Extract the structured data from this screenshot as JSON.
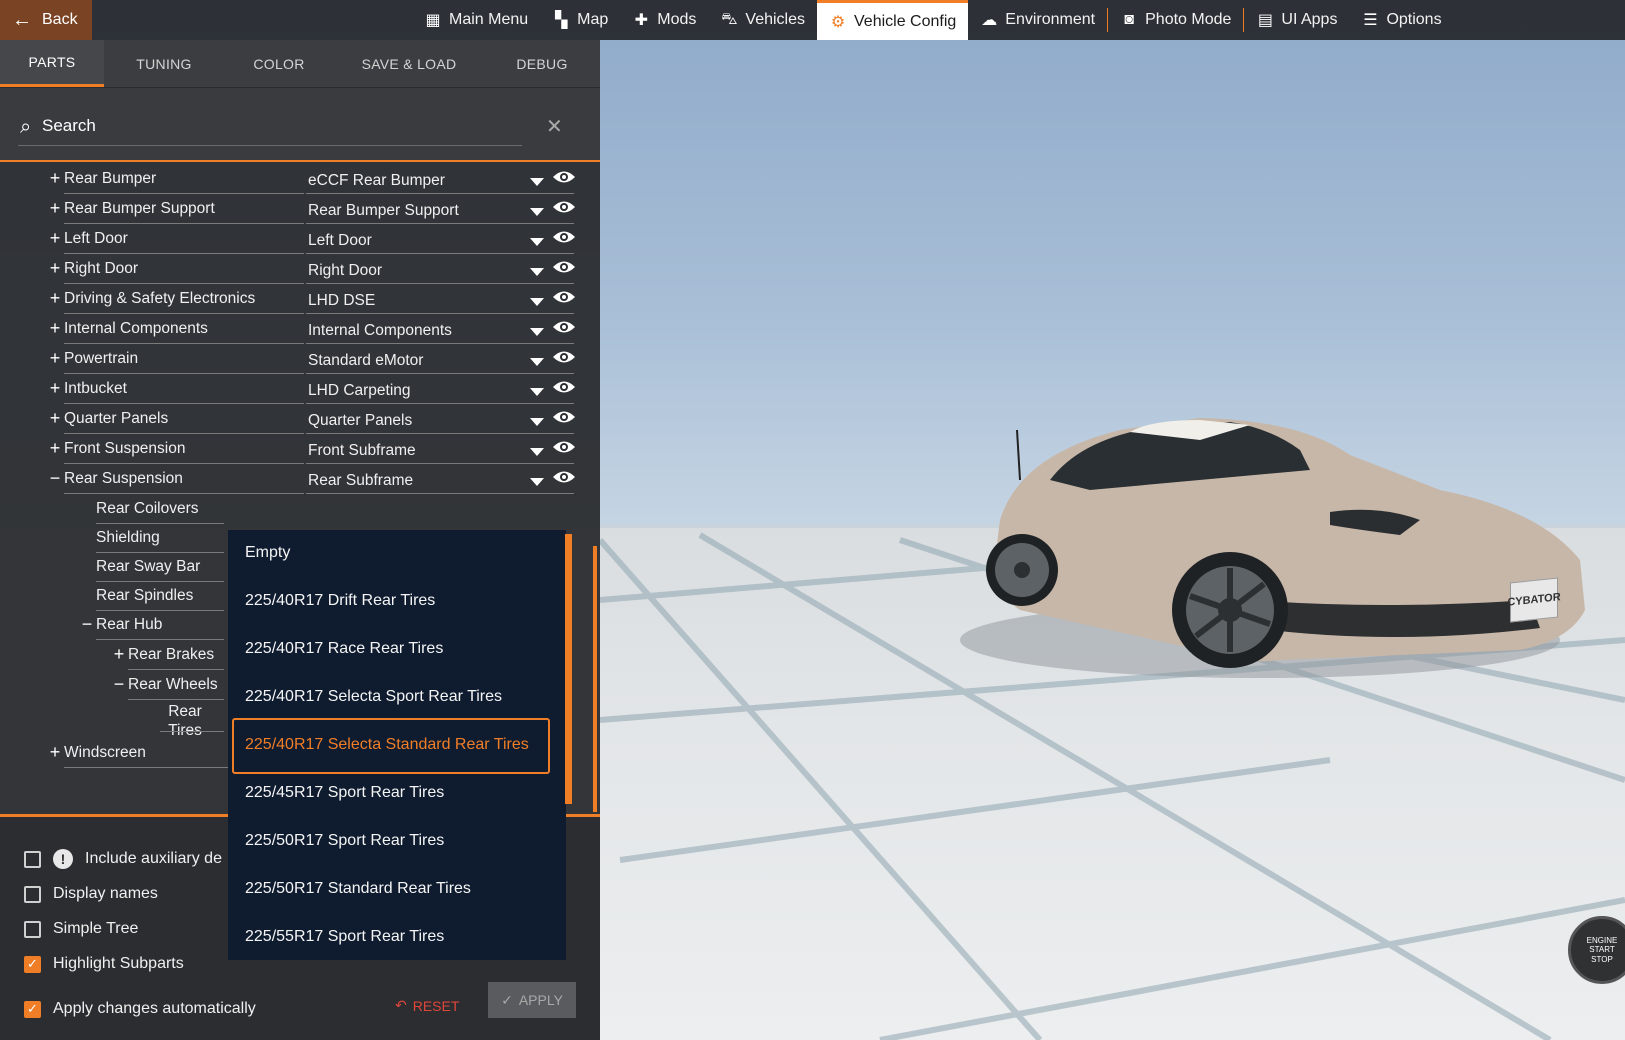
{
  "topbar": {
    "back_label": "Back",
    "nav": [
      {
        "label": "Main Menu",
        "icon": "grid-icon"
      },
      {
        "label": "Map",
        "icon": "map-icon"
      },
      {
        "label": "Mods",
        "icon": "puzzle-icon"
      },
      {
        "label": "Vehicles",
        "icon": "car-icon"
      },
      {
        "label": "Vehicle Config",
        "icon": "engine-icon",
        "active": true
      },
      {
        "label": "Environment",
        "icon": "weather-icon"
      },
      {
        "label": "Photo Mode",
        "icon": "camera-icon"
      },
      {
        "label": "UI Apps",
        "icon": "apps-icon"
      },
      {
        "label": "Options",
        "icon": "sliders-icon"
      }
    ]
  },
  "tabs": [
    {
      "label": "PARTS",
      "active": true
    },
    {
      "label": "TUNING"
    },
    {
      "label": "COLOR"
    },
    {
      "label": "SAVE & LOAD"
    },
    {
      "label": "DEBUG"
    }
  ],
  "search": {
    "placeholder": "Search"
  },
  "tree": [
    {
      "label": "Rear Bumper",
      "value": "eCCF Rear Bumper",
      "expander": "+",
      "level": 0
    },
    {
      "label": "Rear Bumper Support",
      "value": "Rear Bumper Support",
      "expander": "+",
      "level": 0
    },
    {
      "label": "Left Door",
      "value": "Left Door",
      "expander": "+",
      "level": 0
    },
    {
      "label": "Right Door",
      "value": "Right Door",
      "expander": "+",
      "level": 0
    },
    {
      "label": "Driving & Safety Electronics",
      "value": "LHD DSE",
      "expander": "+",
      "level": 0
    },
    {
      "label": "Internal Components",
      "value": "Internal Components",
      "expander": "+",
      "level": 0
    },
    {
      "label": "Powertrain",
      "value": "Standard eMotor",
      "expander": "+",
      "level": 0
    },
    {
      "label": "Intbucket",
      "value": "LHD Carpeting",
      "expander": "+",
      "level": 0
    },
    {
      "label": "Quarter Panels",
      "value": "Quarter Panels",
      "expander": "+",
      "level": 0
    },
    {
      "label": "Front Suspension",
      "value": "Front Subframe",
      "expander": "+",
      "level": 0
    },
    {
      "label": "Rear Suspension",
      "value": "Rear Subframe",
      "expander": "−",
      "level": 0
    },
    {
      "label": "Rear Coilovers",
      "value": "",
      "expander": "",
      "level": 1
    },
    {
      "label": "Shielding",
      "value": "",
      "expander": "",
      "level": 1
    },
    {
      "label": "Rear Sway Bar",
      "value": "",
      "expander": "",
      "level": 1
    },
    {
      "label": "Rear Spindles",
      "value": "",
      "expander": "",
      "level": 1
    },
    {
      "label": "Rear Hub",
      "value": "",
      "expander": "−",
      "level": 1
    },
    {
      "label": "Rear Brakes",
      "value": "",
      "expander": "+",
      "level": 2
    },
    {
      "label": "Rear Wheels",
      "value": "",
      "expander": "−",
      "level": 2
    },
    {
      "label": "Rear Tires",
      "value": "",
      "expander": "",
      "level": 3
    },
    {
      "label": "Windscreen",
      "value": "",
      "expander": "+",
      "level": 0
    }
  ],
  "dropdown": {
    "options": [
      "Empty",
      "225/40R17 Drift Rear Tires",
      "225/40R17 Race Rear Tires",
      "225/40R17 Selecta Sport Rear Tires",
      "225/40R17 Selecta Standard Rear Tires",
      "225/45R17 Sport Rear Tires",
      "225/50R17 Sport Rear Tires",
      "225/50R17 Standard Rear Tires",
      "225/55R17 Sport Rear Tires"
    ],
    "selected_index": 4
  },
  "options": [
    {
      "label": "Include auxiliary de",
      "checked": false,
      "warning": true
    },
    {
      "label": "Display names",
      "checked": false
    },
    {
      "label": "Simple Tree",
      "checked": false
    },
    {
      "label": "Highlight Subparts",
      "checked": true
    },
    {
      "label": "Apply changes automatically",
      "checked": true
    }
  ],
  "buttons": {
    "reset": "RESET",
    "apply": "APPLY"
  },
  "engine_button": {
    "line1": "ENGINE",
    "line2": "START",
    "line3": "STOP"
  },
  "plate_text": "CYBATOR",
  "colors": {
    "accent": "#f07e26",
    "dropdown_bg": "#0f1c30",
    "panel_bg": "#2c2e31"
  }
}
